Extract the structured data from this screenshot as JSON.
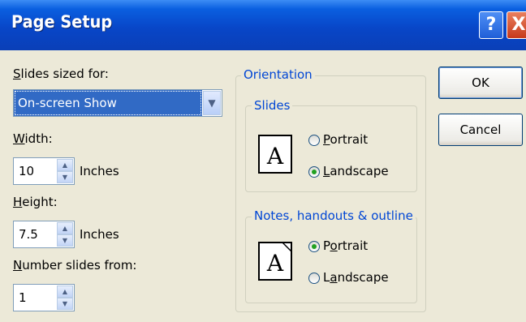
{
  "dialog": {
    "title": "Page Setup",
    "help_label": "?",
    "close_label": "X"
  },
  "slides_sized_for": {
    "label_first": "S",
    "label_rest": "lides sized for:",
    "value": "On-screen Show"
  },
  "width": {
    "label_first": "W",
    "label_rest": "idth:",
    "value": "10",
    "unit": "Inches"
  },
  "height": {
    "label_first": "H",
    "label_rest": "eight:",
    "value": "7.5",
    "unit": "Inches"
  },
  "number_from": {
    "label_first": "N",
    "label_rest": "umber slides from:",
    "value": "1"
  },
  "orientation": {
    "title": "Orientation",
    "slides": {
      "title": "Slides",
      "portrait_first": "P",
      "portrait_rest": "ortrait",
      "landscape_first": "L",
      "landscape_rest": "andscape",
      "selected": "Landscape"
    },
    "notes": {
      "title": "Notes, handouts & outline",
      "portrait_pre": "P",
      "portrait_u": "o",
      "portrait_post": "rtrait",
      "landscape_pre": "L",
      "landscape_u": "a",
      "landscape_post": "ndscape",
      "selected": "Portrait"
    }
  },
  "buttons": {
    "ok": "OK",
    "cancel": "Cancel"
  },
  "icons": {
    "doc_letter": "A"
  }
}
